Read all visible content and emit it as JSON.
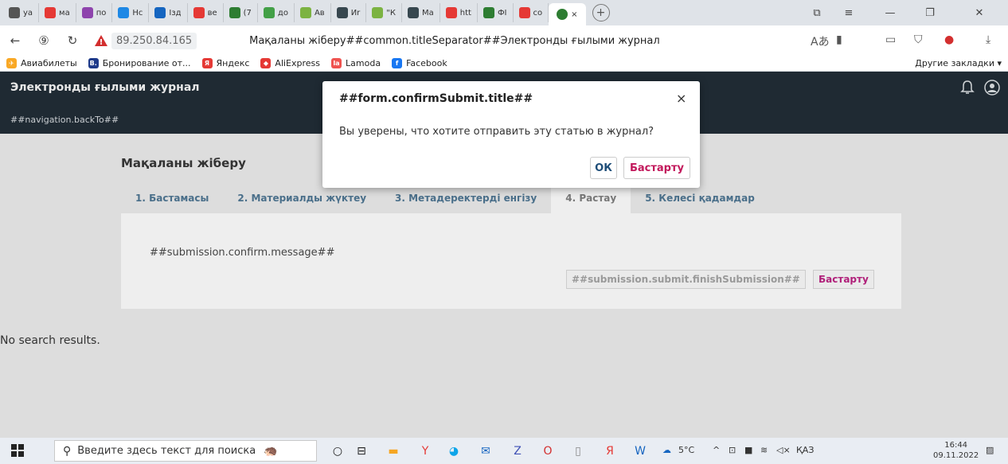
{
  "browser": {
    "tabs": [
      {
        "label": "ya",
        "icon": "doc-icon",
        "color": "#555555"
      },
      {
        "label": "ма",
        "icon": "yandex-icon",
        "color": "#e53935"
      },
      {
        "label": "по",
        "icon": "mail-icon",
        "color": "#8e44ad"
      },
      {
        "label": "Нс",
        "icon": "site-icon",
        "color": "#1e88e5"
      },
      {
        "label": "Iзд",
        "icon": "envelope-icon",
        "color": "#1565c0"
      },
      {
        "label": "ве",
        "icon": "yandex-icon",
        "color": "#e53935"
      },
      {
        "label": "(7",
        "icon": "whatsapp-icon",
        "color": "#2e7d32"
      },
      {
        "label": "до",
        "icon": "drive-icon",
        "color": "#43a047"
      },
      {
        "label": "Ав",
        "icon": "globe-icon",
        "color": "#7cb342"
      },
      {
        "label": "Иr",
        "icon": "pkp-icon",
        "color": "#37474f"
      },
      {
        "label": "\"К",
        "icon": "globe-icon",
        "color": "#7cb342"
      },
      {
        "label": "Ма",
        "icon": "pkp-icon",
        "color": "#37474f"
      },
      {
        "label": "htt",
        "icon": "yandex-icon",
        "color": "#e53935"
      },
      {
        "label": "ФI",
        "icon": "monitor-icon",
        "color": "#2e7d32"
      },
      {
        "label": "co",
        "icon": "yandex-icon",
        "color": "#e53935"
      }
    ],
    "active_tab_close": "×",
    "new_tab": "+",
    "url": "89.250.84.165",
    "page_title": "Мақаланы жіберу##common.titleSeparator##Электронды ғылыми журнал",
    "bookmarks": [
      {
        "label": "Авиабилеты",
        "icon": "plane-icon",
        "color": "#f9a825",
        "glyph": "✈"
      },
      {
        "label": "Бронирование от...",
        "icon": "booking-icon",
        "color": "#1e3a8a",
        "glyph": "B."
      },
      {
        "label": "Яндекс",
        "icon": "yandex-icon",
        "color": "#e53935",
        "glyph": "Я"
      },
      {
        "label": "AliExpress",
        "icon": "aliexpress-icon",
        "color": "#e53935",
        "glyph": "◆"
      },
      {
        "label": "Lamoda",
        "icon": "lamoda-icon",
        "color": "#ef5350",
        "glyph": "la"
      },
      {
        "label": "Facebook",
        "icon": "facebook-icon",
        "color": "#1877f2",
        "glyph": "f"
      }
    ],
    "other_bookmarks": "Другие закладки ▾"
  },
  "app": {
    "name": "Электронды ғылыми журнал",
    "back_to": "##navigation.backTo##"
  },
  "submission": {
    "title": "Мақаланы жіберу",
    "steps": [
      {
        "label": "1. Бастамасы",
        "active": false
      },
      {
        "label": "2. Материалды жүктеу",
        "active": false
      },
      {
        "label": "3. Метадеректерді енгізу",
        "active": false
      },
      {
        "label": "4. Растау",
        "active": true
      },
      {
        "label": "5. Келесі қадамдар",
        "active": false
      }
    ],
    "confirm_message": "##submission.confirm.message##",
    "finish_label": "##submission.submit.finishSubmission##",
    "cancel_label": "Бастарту"
  },
  "no_results": "No search results.",
  "modal": {
    "title": "##form.confirmSubmit.title##",
    "close": "×",
    "message": "Вы уверены, что хотите отправить эту статью в журнал?",
    "ok_label": "ОК",
    "cancel_label": "Бастарту"
  },
  "taskbar": {
    "search_placeholder": "Введите здесь текст для поиска",
    "weather": "5°C",
    "lang": "ҚАЗ",
    "time": "16:44",
    "date": "09.11.2022"
  }
}
